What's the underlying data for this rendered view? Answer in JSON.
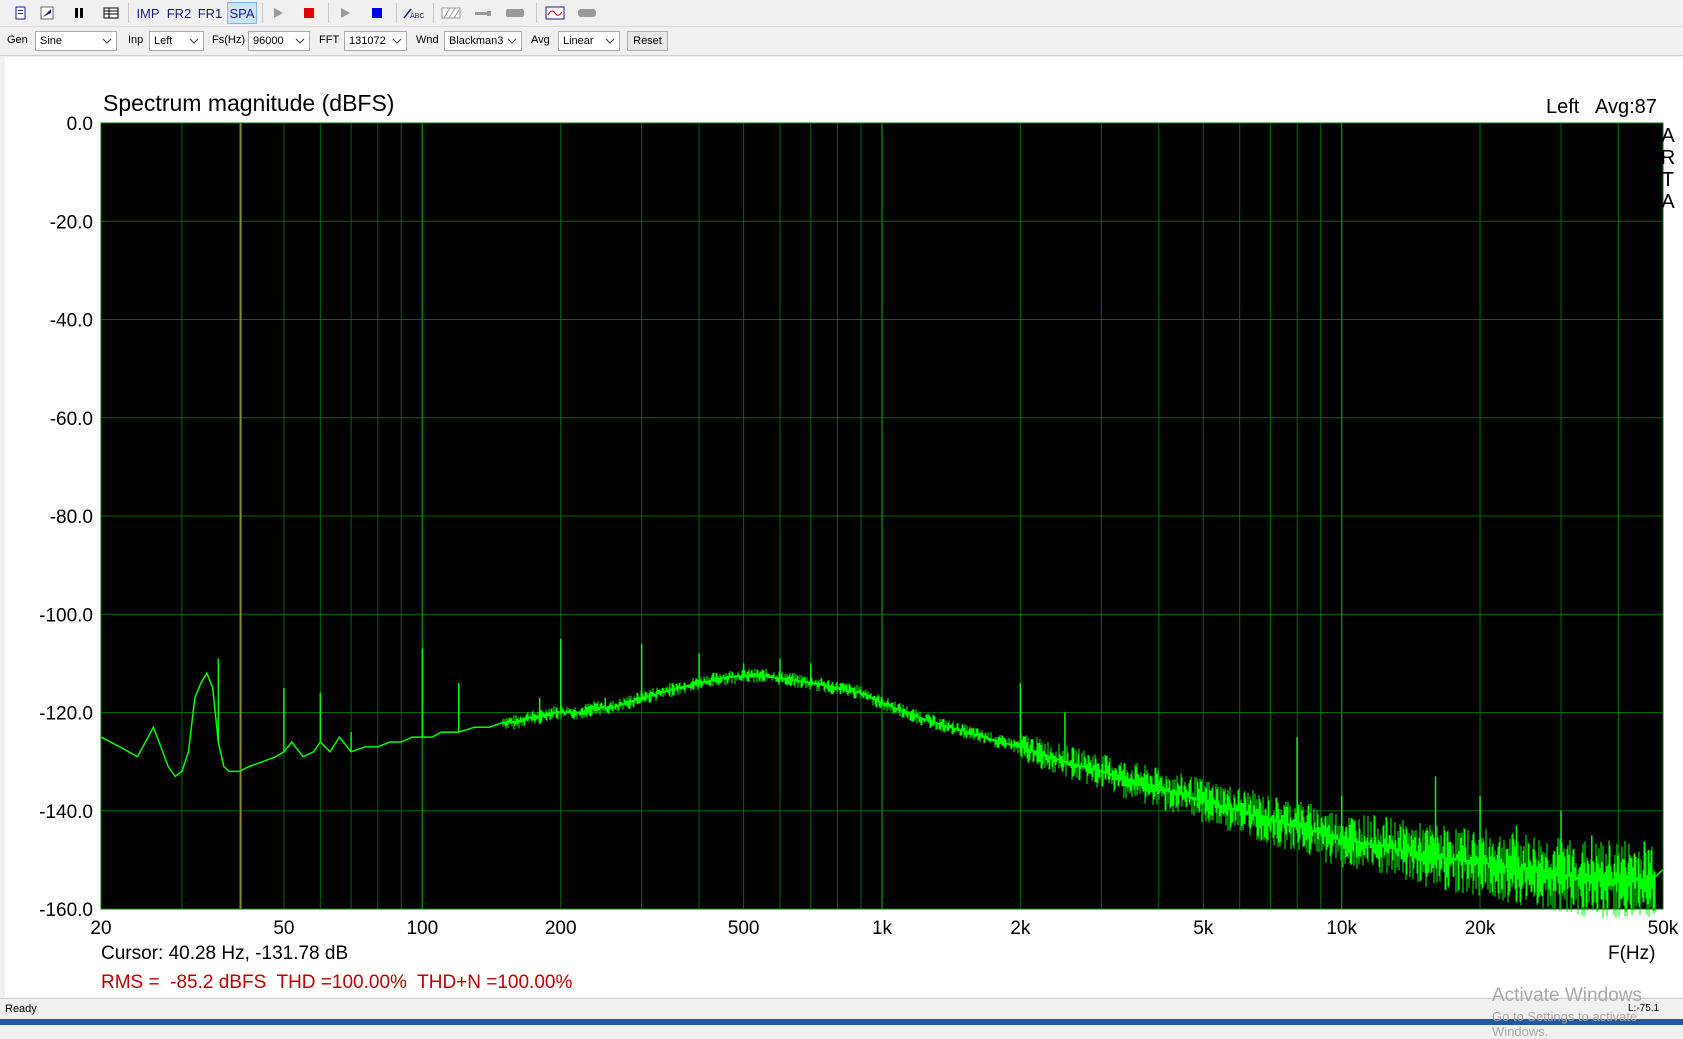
{
  "toolbar": {
    "buttons": [
      {
        "name": "new-file",
        "type": "icon"
      },
      {
        "name": "open",
        "type": "icon"
      },
      {
        "name": "pause",
        "type": "icon"
      },
      {
        "name": "table",
        "type": "icon"
      },
      {
        "name": "imp",
        "label": "IMP"
      },
      {
        "name": "fr2",
        "label": "FR2"
      },
      {
        "name": "fr1",
        "label": "FR1"
      },
      {
        "name": "spa",
        "label": "SPA",
        "active": true
      },
      {
        "name": "play-gray",
        "type": "icon"
      },
      {
        "name": "stop-red",
        "type": "icon"
      },
      {
        "name": "play-gray-2",
        "type": "icon"
      },
      {
        "name": "stop-blue",
        "type": "icon"
      },
      {
        "name": "abc",
        "type": "icon"
      },
      {
        "name": "hatch",
        "type": "icon"
      },
      {
        "name": "probe",
        "type": "icon"
      },
      {
        "name": "bar",
        "type": "icon"
      },
      {
        "name": "scope",
        "type": "icon"
      },
      {
        "name": "gray-rect",
        "type": "icon"
      }
    ],
    "imp_label": "IMP",
    "fr2_label": "FR2",
    "fr1_label": "FR1",
    "spa_label": "SPA"
  },
  "settings": {
    "gen_label": "Gen",
    "gen_value": "Sine",
    "inp_label": "Inp",
    "inp_value": "Left",
    "fs_label": "Fs(Hz)",
    "fs_value": "96000",
    "fft_label": "FFT",
    "fft_value": "131072",
    "wnd_label": "Wnd",
    "wnd_value": "Blackman3",
    "avg_label": "Avg",
    "avg_value": "Linear",
    "reset_label": "Reset"
  },
  "plot": {
    "title": "Spectrum magnitude (dBFS)",
    "channel": "Left",
    "avg": "Avg:87",
    "watermark_letters": [
      "A",
      "R",
      "T",
      "A"
    ],
    "cursor": "Cursor: 40.28 Hz, -131.78 dB",
    "x_unit": "F(Hz)",
    "stats": "RMS =  -85.2 dBFS  THD =100.00%  THD+N =100.00%",
    "colors": {
      "background": "#000000",
      "grid": "#006a00",
      "trace": "#00ff00",
      "cursor": "#8f8f2a",
      "stats": "#c00000"
    }
  },
  "chart_data": {
    "type": "line",
    "title": "Spectrum magnitude (dBFS)",
    "xlabel": "F(Hz)",
    "ylabel": "",
    "xscale": "log",
    "xlim": [
      20,
      50000
    ],
    "ylim": [
      -160,
      0
    ],
    "grid": true,
    "yticks": [
      0,
      -20,
      -40,
      -60,
      -80,
      -100,
      -120,
      -140,
      -160
    ],
    "ytick_labels": [
      "0.0",
      "-20.0",
      "-40.0",
      "-60.0",
      "-80.0",
      "-100.0",
      "-120.0",
      "-140.0",
      "-160.0"
    ],
    "xticks": [
      20,
      50,
      100,
      200,
      500,
      1000,
      2000,
      5000,
      10000,
      20000,
      50000
    ],
    "xtick_labels": [
      "20",
      "50",
      "100",
      "200",
      "500",
      "1k",
      "2k",
      "5k",
      "10k",
      "20k",
      "50k"
    ],
    "cursor_x": 40.28,
    "series": [
      {
        "x": [
          20,
          22,
          24,
          25,
          26,
          27,
          28,
          29,
          30,
          31,
          32,
          33,
          34,
          35,
          36,
          37,
          38,
          40,
          42,
          45,
          48,
          50,
          52,
          55,
          58,
          60,
          63,
          66,
          70,
          75,
          80,
          85,
          90,
          95,
          100,
          105,
          110,
          115,
          120,
          130,
          140,
          150,
          160,
          170,
          180,
          190,
          200,
          220,
          240,
          260,
          280,
          300,
          330,
          360,
          400,
          450,
          500,
          550,
          600,
          650,
          700,
          800,
          900,
          1000,
          1200,
          1400,
          1600,
          1800,
          2000,
          2500,
          3000,
          3500,
          4000,
          5000,
          6000,
          7000,
          8000,
          10000,
          12000,
          15000,
          18000,
          20000,
          25000,
          28000,
          30000,
          32000,
          35000,
          40000,
          45000,
          48000,
          50000
        ],
        "y": [
          -125,
          -127,
          -129,
          -126,
          -123,
          -127,
          -131,
          -133,
          -132,
          -128,
          -117,
          -114,
          -112,
          -115,
          -126,
          -131,
          -132,
          -132,
          -131,
          -130,
          -129,
          -128,
          -126,
          -129,
          -128,
          -126,
          -128,
          -125,
          -128,
          -127,
          -127,
          -126,
          -126,
          -125,
          -125,
          -125,
          -124,
          -124,
          -124,
          -123,
          -123,
          -122,
          -122,
          -121,
          -121,
          -120,
          -120,
          -120,
          -119,
          -119,
          -118,
          -117,
          -116,
          -115,
          -114,
          -113,
          -112.5,
          -112.5,
          -113,
          -113.5,
          -114,
          -115,
          -116,
          -118,
          -121,
          -123,
          -124.5,
          -126,
          -127,
          -130,
          -132,
          -134,
          -135.5,
          -138,
          -140,
          -142,
          -143,
          -146,
          -147,
          -149,
          -150,
          -150.5,
          -152,
          -152.5,
          -153,
          -153.5,
          -154,
          -154,
          -154,
          -153.5,
          -152
        ]
      }
    ],
    "harmonics": [
      {
        "x": 36,
        "y": -109
      },
      {
        "x": 50,
        "y": -115
      },
      {
        "x": 60,
        "y": -116
      },
      {
        "x": 70,
        "y": -124
      },
      {
        "x": 100,
        "y": -107
      },
      {
        "x": 120,
        "y": -114
      },
      {
        "x": 150,
        "y": -122
      },
      {
        "x": 180,
        "y": -117
      },
      {
        "x": 200,
        "y": -105
      },
      {
        "x": 250,
        "y": -117
      },
      {
        "x": 300,
        "y": -106
      },
      {
        "x": 400,
        "y": -108
      },
      {
        "x": 500,
        "y": -110
      },
      {
        "x": 600,
        "y": -109
      },
      {
        "x": 700,
        "y": -110
      },
      {
        "x": 2000,
        "y": -114
      },
      {
        "x": 2500,
        "y": -120
      },
      {
        "x": 8000,
        "y": -125
      },
      {
        "x": 10000,
        "y": -137
      },
      {
        "x": 16000,
        "y": -133
      },
      {
        "x": 20000,
        "y": -137
      },
      {
        "x": 24000,
        "y": -143
      },
      {
        "x": 30000,
        "y": -140
      },
      {
        "x": 35000,
        "y": -145
      }
    ]
  },
  "status": {
    "text": "Ready",
    "right": "L:-75.1"
  },
  "watermark": {
    "line1": "Activate Windows",
    "line2": "Go to Settings to activate Windows."
  }
}
